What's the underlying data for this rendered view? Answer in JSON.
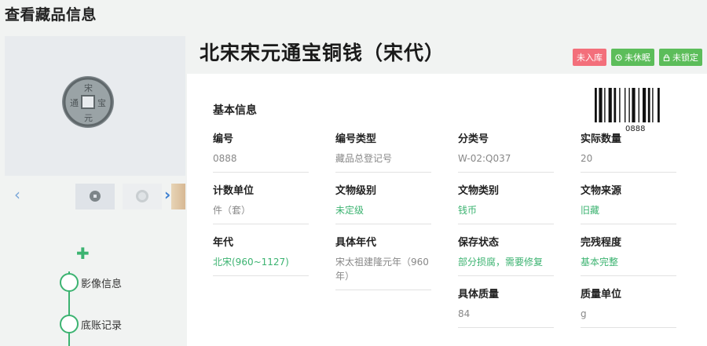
{
  "page": {
    "title": "查看藏品信息"
  },
  "object": {
    "title": "北宋宋元通宝铜钱（宋代）"
  },
  "badges": [
    {
      "label": "未入库",
      "color": "#f36f7b",
      "icon": ""
    },
    {
      "label": "未休眠",
      "color": "#5cbd5a",
      "icon": "clock-icon"
    },
    {
      "label": "未锁定",
      "color": "#5cbd5a",
      "icon": "lock-icon"
    }
  ],
  "gallery": {
    "prev_icon": "chevron-left-icon",
    "next_icon": "chevron-right-icon"
  },
  "barcode": {
    "number": "0888"
  },
  "basic": {
    "title": "基本信息",
    "fields": [
      {
        "label": "编号",
        "value": "0888"
      },
      {
        "label": "编号类型",
        "value": "藏品总登记号"
      },
      {
        "label": "分类号",
        "value": "W-02:Q037"
      },
      {
        "label": "实际数量",
        "value": "20"
      },
      {
        "label": "计数单位",
        "value": "件（套）"
      },
      {
        "label": "文物级别",
        "value": "未定级"
      },
      {
        "label": "文物类别",
        "value": "钱币"
      },
      {
        "label": "文物来源",
        "value": "旧藏"
      },
      {
        "label": "年代",
        "value": "北宋(960~1127)"
      },
      {
        "label": "具体年代",
        "value": "宋太祖建隆元年（960年）"
      },
      {
        "label": "保存状态",
        "value": "部分损腐，需要修复"
      },
      {
        "label": "完残程度",
        "value": "基本完整"
      },
      {
        "label": "具体质量",
        "value": "84"
      },
      {
        "label": "质量单位",
        "value": "g"
      }
    ]
  },
  "timeline": {
    "add_icon": "plus-icon",
    "items": [
      {
        "label": "影像信息"
      },
      {
        "label": "底账记录"
      }
    ]
  }
}
